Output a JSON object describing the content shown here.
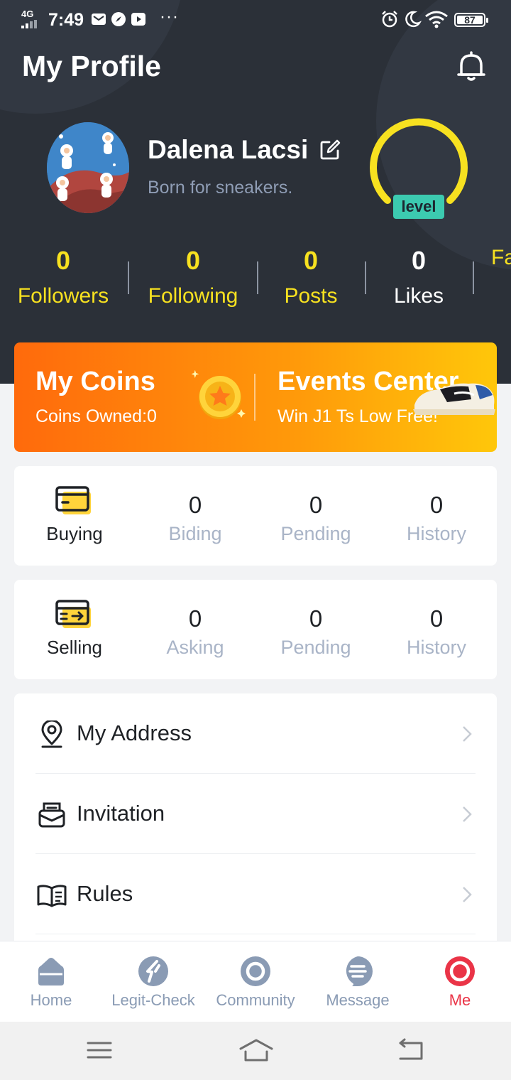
{
  "status_bar": {
    "network": "4G",
    "time": "7:49",
    "more": "···",
    "battery": "87"
  },
  "header": {
    "title": "My Profile"
  },
  "profile": {
    "name": "Dalena Lacsi",
    "bio": "Born for sneakers.",
    "level_label": "level"
  },
  "stats": [
    {
      "value": "0",
      "label": "Followers"
    },
    {
      "value": "0",
      "label": "Following"
    },
    {
      "value": "0",
      "label": "Posts"
    },
    {
      "value": "0",
      "label": "Likes"
    },
    {
      "value": "",
      "label": "Fa"
    }
  ],
  "banner": {
    "coins_title": "My Coins",
    "coins_sub": "Coins Owned:0",
    "events_title": "Events Center",
    "events_sub": "Win J1 Ts Low Free!"
  },
  "buying": {
    "title": "Buying",
    "items": [
      {
        "count": "0",
        "label": "Biding"
      },
      {
        "count": "0",
        "label": "Pending"
      },
      {
        "count": "0",
        "label": "History"
      }
    ]
  },
  "selling": {
    "title": "Selling",
    "items": [
      {
        "count": "0",
        "label": "Asking"
      },
      {
        "count": "0",
        "label": "Pending"
      },
      {
        "count": "0",
        "label": "History"
      }
    ]
  },
  "menu": [
    {
      "label": "My Address",
      "icon": "location-pin-icon"
    },
    {
      "label": "Invitation",
      "icon": "envelope-icon"
    },
    {
      "label": "Rules",
      "icon": "book-icon"
    }
  ],
  "tabs": [
    {
      "label": "Home",
      "icon": "home-icon"
    },
    {
      "label": "Legit-Check",
      "icon": "legit-check-icon"
    },
    {
      "label": "Community",
      "icon": "community-icon"
    },
    {
      "label": "Message",
      "icon": "message-icon"
    },
    {
      "label": "Me",
      "icon": "me-icon",
      "active": true
    }
  ],
  "colors": {
    "header_bg": "#2b3038",
    "accent_yellow": "#f7e120",
    "level_green": "#3ccab0",
    "banner_orange": "#ff6a0c",
    "active_red": "#ea3447",
    "inactive_tab": "#8a9bb4"
  }
}
